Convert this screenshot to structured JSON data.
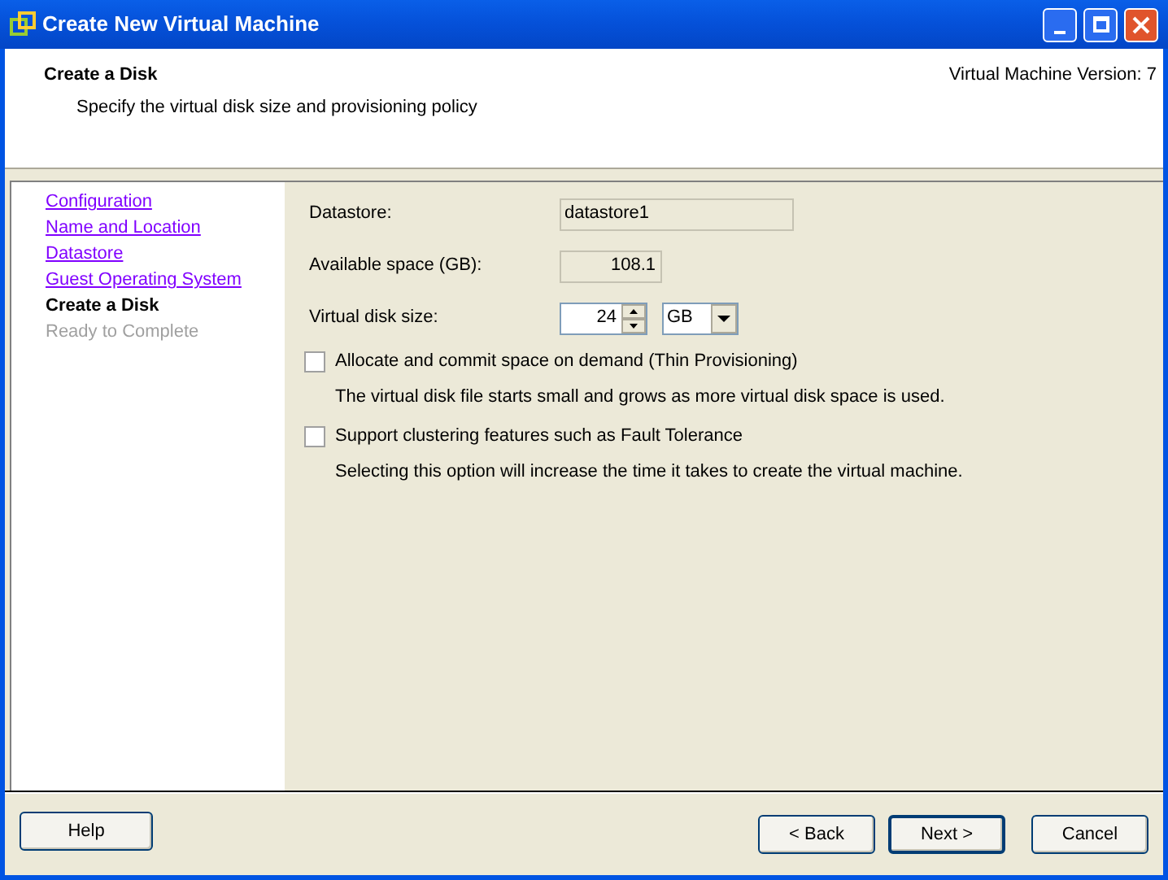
{
  "window": {
    "title": "Create New Virtual Machine"
  },
  "header": {
    "title": "Create a Disk",
    "subtitle": "Specify the virtual disk size and provisioning policy",
    "version": "Virtual Machine Version: 7"
  },
  "steps": [
    {
      "label": "Configuration",
      "selected": false,
      "disabled": false
    },
    {
      "label": "Name and Location",
      "selected": false,
      "disabled": false
    },
    {
      "label": "Datastore",
      "selected": false,
      "disabled": false
    },
    {
      "label": "Guest Operating System",
      "selected": false,
      "disabled": false
    },
    {
      "label": "Create a Disk",
      "selected": true,
      "disabled": false
    },
    {
      "label": "Ready to Complete",
      "selected": false,
      "disabled": true
    }
  ],
  "fields": {
    "datastore": {
      "label": "Datastore:",
      "value": "datastore1"
    },
    "available": {
      "label": "Available space (GB):",
      "value": "108.1"
    },
    "size": {
      "label": "Virtual disk size:",
      "value": "24",
      "unit": "GB"
    }
  },
  "options": [
    {
      "label": "Allocate and commit space on demand (Thin Provisioning)",
      "checked": false,
      "description": "The virtual disk file starts small and grows as more virtual disk space is used."
    },
    {
      "label": "Support clustering features such as Fault Tolerance",
      "checked": false,
      "description": "Selecting this option will increase the time it takes to create the virtual machine."
    }
  ],
  "buttons": {
    "help": "Help",
    "back": "< Back",
    "next": "Next >",
    "cancel": "Cancel"
  }
}
